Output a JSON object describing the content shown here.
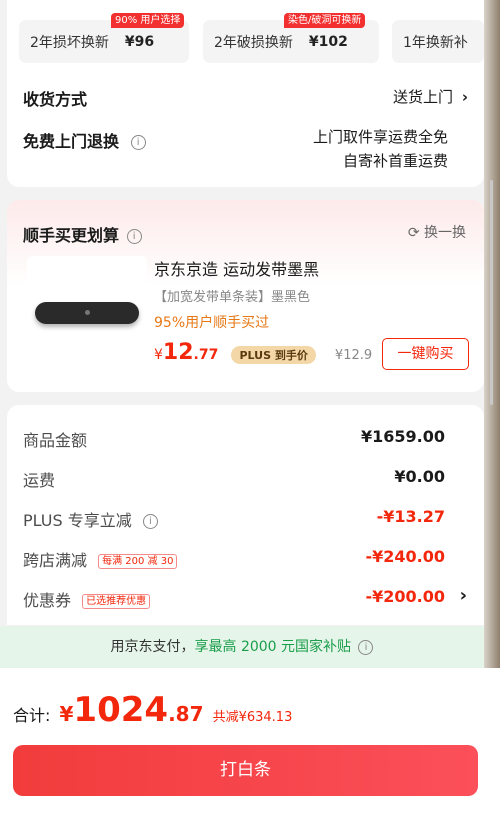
{
  "services": [
    {
      "name": "2年损坏换新",
      "price": "¥96",
      "tag": "90% 用户选择"
    },
    {
      "name": "2年破损换新",
      "price": "¥102",
      "tag": "染色/破洞可换新"
    },
    {
      "name": "1年换新补",
      "price": "",
      "tag": ""
    }
  ],
  "delivery": {
    "label": "收货方式",
    "value": "送货上门"
  },
  "free_return": {
    "label": "免费上门退换",
    "value_line1": "上门取件享运费全免",
    "value_line2": "自寄补首重运费"
  },
  "bundle": {
    "title": "顺手买更划算",
    "refresh": "换一换",
    "product": {
      "name": "京东京造 运动发带墨黑",
      "spec": "【加宽发带单条装】墨黑色",
      "promo": "95%用户顺手买过",
      "price_currency": "¥",
      "price_int": "12",
      "price_dec": ".77",
      "plus_badge": "PLUS 到手价",
      "orig_price": "¥12.9",
      "buy_button": "一键购买"
    }
  },
  "summary": {
    "goods_label": "商品金额",
    "goods_value": "¥1659.00",
    "shipping_label": "运费",
    "shipping_value": "¥0.00",
    "plus_label": "PLUS 专享立减",
    "plus_value": "-¥13.27",
    "cross_label": "跨店满减",
    "cross_tag": "每满 200 减 30",
    "cross_value": "-¥240.00",
    "coupon_label": "优惠券",
    "coupon_tag": "已选推荐优惠",
    "coupon_value": "-¥200.00"
  },
  "pay_banner": {
    "prefix": "用京东支付，",
    "highlight": "享最高 2000 元国家补贴"
  },
  "total": {
    "label": "合计:",
    "currency": "¥",
    "int": "1024",
    "dec": ".87",
    "saved": "共减¥634.13"
  },
  "submit_button": "打白条",
  "colors": {
    "accent": "#f2270c",
    "banner_bg": "#e6f5ea",
    "banner_green": "#1a9e4a",
    "plus_gold": "#f3d7a7"
  }
}
